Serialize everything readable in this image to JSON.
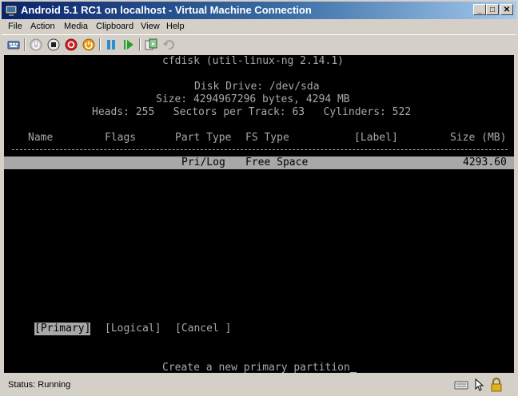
{
  "window": {
    "title": "Android 5.1 RC1 on localhost - Virtual Machine Connection",
    "controls": {
      "minimize": "_",
      "maximize": "□",
      "close": "✕"
    }
  },
  "menu": [
    "File",
    "Action",
    "Media",
    "Clipboard",
    "View",
    "Help"
  ],
  "toolbar_icons": [
    "ctrl-alt-del-icon",
    "start-icon",
    "turn-off-icon",
    "shutdown-icon",
    "reset-icon",
    "pause-icon",
    "resume-icon",
    "snapshot-icon",
    "revert-icon"
  ],
  "console": {
    "program": "cfdisk (util-linux-ng 2.14.1)",
    "disk_drive": "Disk Drive: /dev/sda",
    "size_line": "Size: 4294967296 bytes, 4294 MB",
    "geometry": "Heads: 255   Sectors per Track: 63   Cylinders: 522",
    "headers": {
      "name": "Name",
      "flags": "Flags",
      "part_type": "Part Type",
      "fs_type": "FS Type",
      "label": "[Label]",
      "size": "Size (MB)"
    },
    "row": {
      "part_type": "Pri/Log",
      "fs_type": "Free Space",
      "size": "4293.60"
    },
    "buttons": [
      "[Primary]",
      "[Logical]",
      "[Cancel ]"
    ],
    "prompt": "Create a new primary partition"
  },
  "status": {
    "text": "Status: Running"
  },
  "colors": {
    "console_bg": "#000000",
    "console_fg": "#a8a8a8",
    "title_start": "#0a246a",
    "title_end": "#a6caf0"
  }
}
